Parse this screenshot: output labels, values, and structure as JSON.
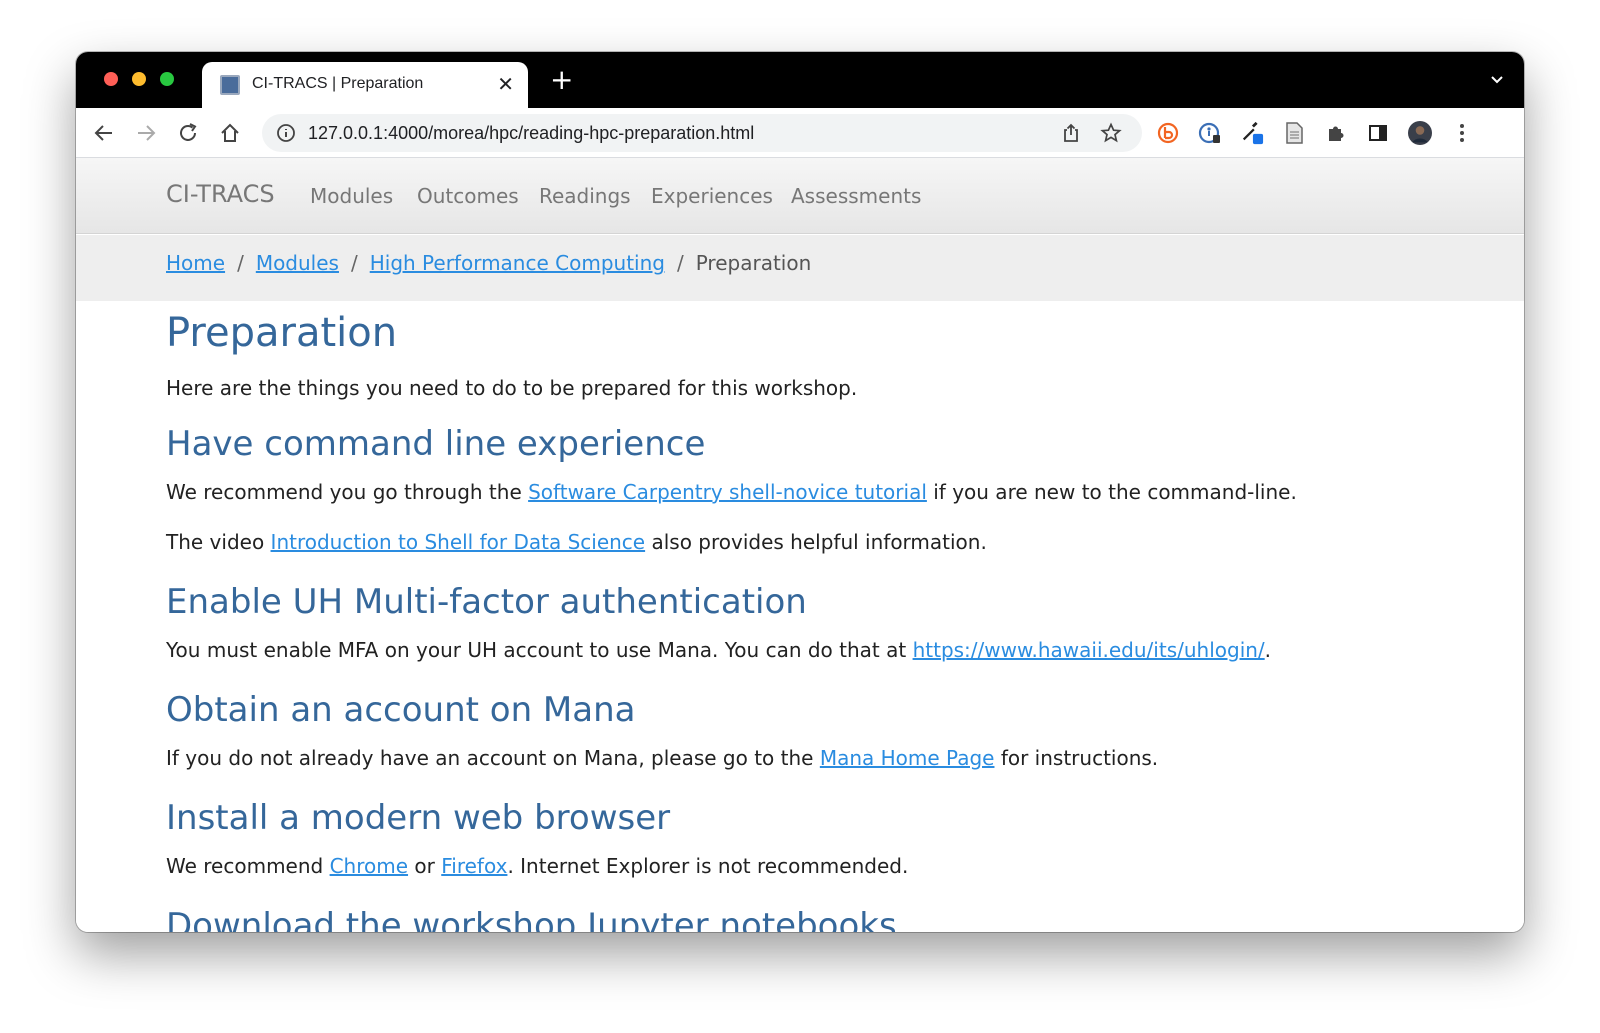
{
  "browser": {
    "tab_title": "CI-TRACS | Preparation",
    "tab_close": "✕",
    "new_tab": "+",
    "url": "127.0.0.1:4000/morea/hpc/reading-hpc-preparation.html"
  },
  "site": {
    "brand": "CI-TRACS",
    "nav": [
      "Modules",
      "Outcomes",
      "Readings",
      "Experiences",
      "Assessments"
    ]
  },
  "breadcrumb": {
    "items": [
      "Home",
      "Modules",
      "High Performance Computing"
    ],
    "separator": "/",
    "current": "Preparation"
  },
  "content": {
    "title": "Preparation",
    "intro": "Here are the things you need to do to be prepared for this workshop.",
    "sections": [
      {
        "heading": "Have command line experience",
        "p1_before": "We recommend you go through the ",
        "p1_link": "Software Carpentry shell-novice tutorial",
        "p1_after": " if you are new to the command-line.",
        "p2_before": "The video ",
        "p2_link": "Introduction to Shell for Data Science",
        "p2_after": " also provides helpful information."
      },
      {
        "heading": "Enable UH Multi-factor authentication",
        "p_before": "You must enable MFA on your UH account to use Mana. You can do that at ",
        "p_link": "https://www.hawaii.edu/its/uhlogin/",
        "p_after": "."
      },
      {
        "heading": "Obtain an account on Mana",
        "p_before": "If you do not already have an account on Mana, please go to the ",
        "p_link": "Mana Home Page",
        "p_after": " for instructions."
      },
      {
        "heading": "Install a modern web browser",
        "p_before": "We recommend ",
        "p_link1": "Chrome",
        "p_mid": " or ",
        "p_link2": "Firefox",
        "p_after": ". Internet Explorer is not recommended."
      },
      {
        "heading": "Download the workshop Jupyter notebooks"
      }
    ]
  },
  "colors": {
    "heading": "#35679a",
    "link": "#2a8ce0",
    "navbar_text": "#777777"
  }
}
